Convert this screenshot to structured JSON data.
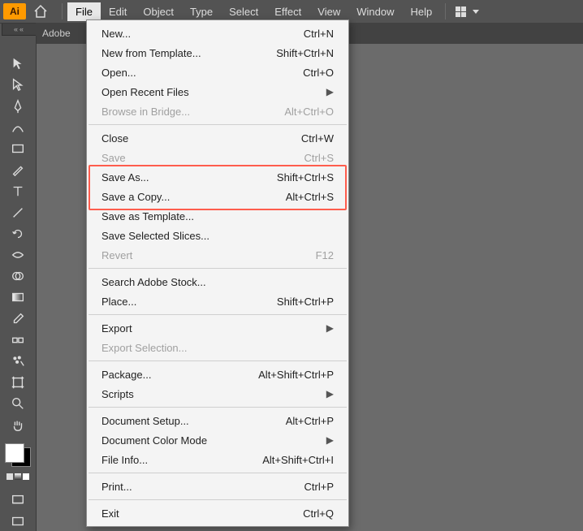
{
  "logo": "Ai",
  "menubar": [
    "File",
    "Edit",
    "Object",
    "Type",
    "Select",
    "Effect",
    "View",
    "Window",
    "Help"
  ],
  "menubar_active": "File",
  "doc_tab": "Adobe",
  "dropdown": {
    "groups": [
      [
        {
          "label": "New...",
          "shortcut": "Ctrl+N"
        },
        {
          "label": "New from Template...",
          "shortcut": "Shift+Ctrl+N"
        },
        {
          "label": "Open...",
          "shortcut": "Ctrl+O"
        },
        {
          "label": "Open Recent Files",
          "submenu": true
        },
        {
          "label": "Browse in Bridge...",
          "shortcut": "Alt+Ctrl+O",
          "disabled": true
        }
      ],
      [
        {
          "label": "Close",
          "shortcut": "Ctrl+W"
        },
        {
          "label": "Save",
          "shortcut": "Ctrl+S",
          "disabled": true
        },
        {
          "label": "Save As...",
          "shortcut": "Shift+Ctrl+S"
        },
        {
          "label": "Save a Copy...",
          "shortcut": "Alt+Ctrl+S"
        },
        {
          "label": "Save as Template..."
        },
        {
          "label": "Save Selected Slices..."
        },
        {
          "label": "Revert",
          "shortcut": "F12",
          "disabled": true
        }
      ],
      [
        {
          "label": "Search Adobe Stock..."
        },
        {
          "label": "Place...",
          "shortcut": "Shift+Ctrl+P"
        }
      ],
      [
        {
          "label": "Export",
          "submenu": true
        },
        {
          "label": "Export Selection...",
          "disabled": true
        }
      ],
      [
        {
          "label": "Package...",
          "shortcut": "Alt+Shift+Ctrl+P"
        },
        {
          "label": "Scripts",
          "submenu": true
        }
      ],
      [
        {
          "label": "Document Setup...",
          "shortcut": "Alt+Ctrl+P"
        },
        {
          "label": "Document Color Mode",
          "submenu": true
        },
        {
          "label": "File Info...",
          "shortcut": "Alt+Shift+Ctrl+I"
        }
      ],
      [
        {
          "label": "Print...",
          "shortcut": "Ctrl+P"
        }
      ],
      [
        {
          "label": "Exit",
          "shortcut": "Ctrl+Q"
        }
      ]
    ]
  },
  "highlight": {
    "targets": [
      "Save As...",
      "Save a Copy..."
    ]
  },
  "tools": [
    "selection",
    "direct-selection",
    "pen",
    "curvature",
    "rectangle",
    "paintbrush",
    "type",
    "line",
    "rotate",
    "width",
    "mesh",
    "shape-builder",
    "gradient",
    "eyedropper",
    "blend",
    "symbol-sprayer",
    "artboard",
    "slice",
    "zoom",
    "hand"
  ]
}
